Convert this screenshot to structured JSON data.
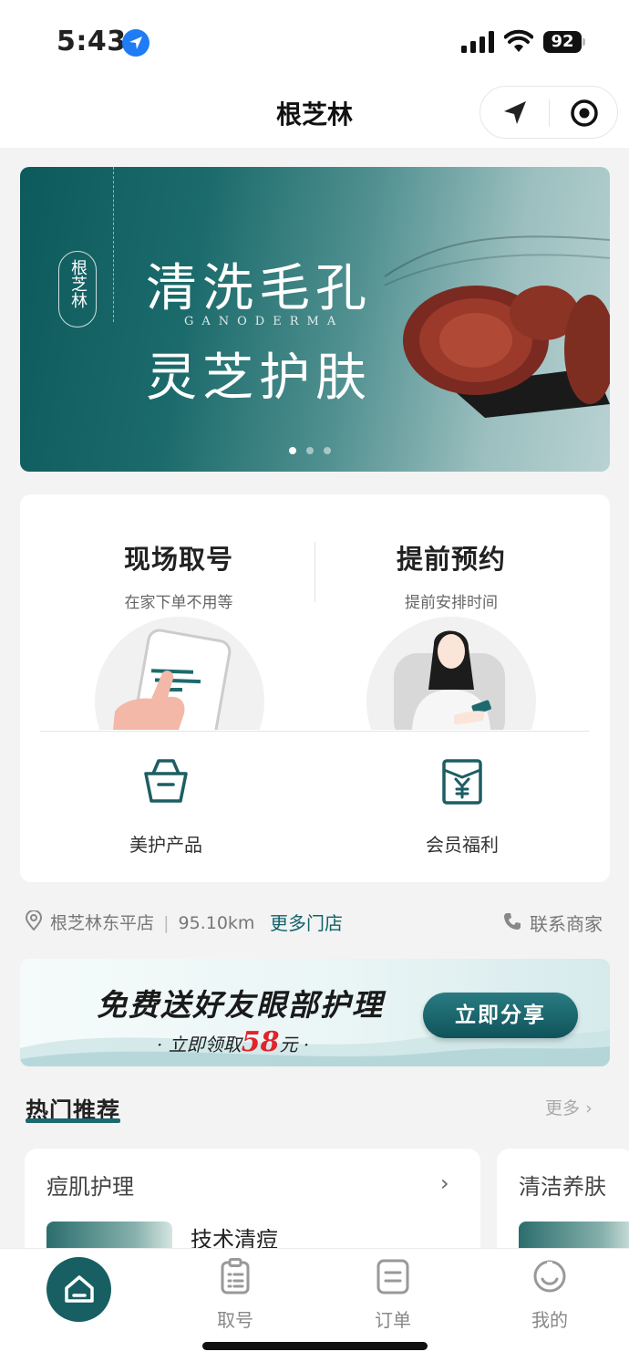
{
  "status_bar": {
    "time": "5:43",
    "battery": "92"
  },
  "navbar": {
    "title": "根芝林"
  },
  "banner": {
    "brand": "根芝林",
    "line1": "清洗毛孔",
    "en": "GANODERMA",
    "line2": "灵芝护肤"
  },
  "services": [
    {
      "title": "现场取号",
      "subtitle": "在家下单不用等"
    },
    {
      "title": "提前预约",
      "subtitle": "提前安排时间"
    }
  ],
  "quick_links": [
    {
      "label": "美护产品",
      "icon": "basket-icon"
    },
    {
      "label": "会员福利",
      "icon": "yuan-envelope-icon"
    }
  ],
  "store": {
    "name": "根芝林东平店",
    "distance": "95.10km",
    "more": "更多门店",
    "contact": "联系商家"
  },
  "promo": {
    "headline": "免费送好友眼部护理",
    "sub_prefix": "· 立即领取",
    "amount": "58",
    "sub_suffix": "元 ·",
    "button": "立即分享"
  },
  "hot": {
    "title": "热门推荐",
    "more": "更多",
    "cards": [
      {
        "title": "痘肌护理",
        "item": "技术清痘"
      },
      {
        "title": "清洁养肤"
      }
    ]
  },
  "tabbar": {
    "tabs": [
      "取号",
      "订单",
      "我的"
    ]
  }
}
